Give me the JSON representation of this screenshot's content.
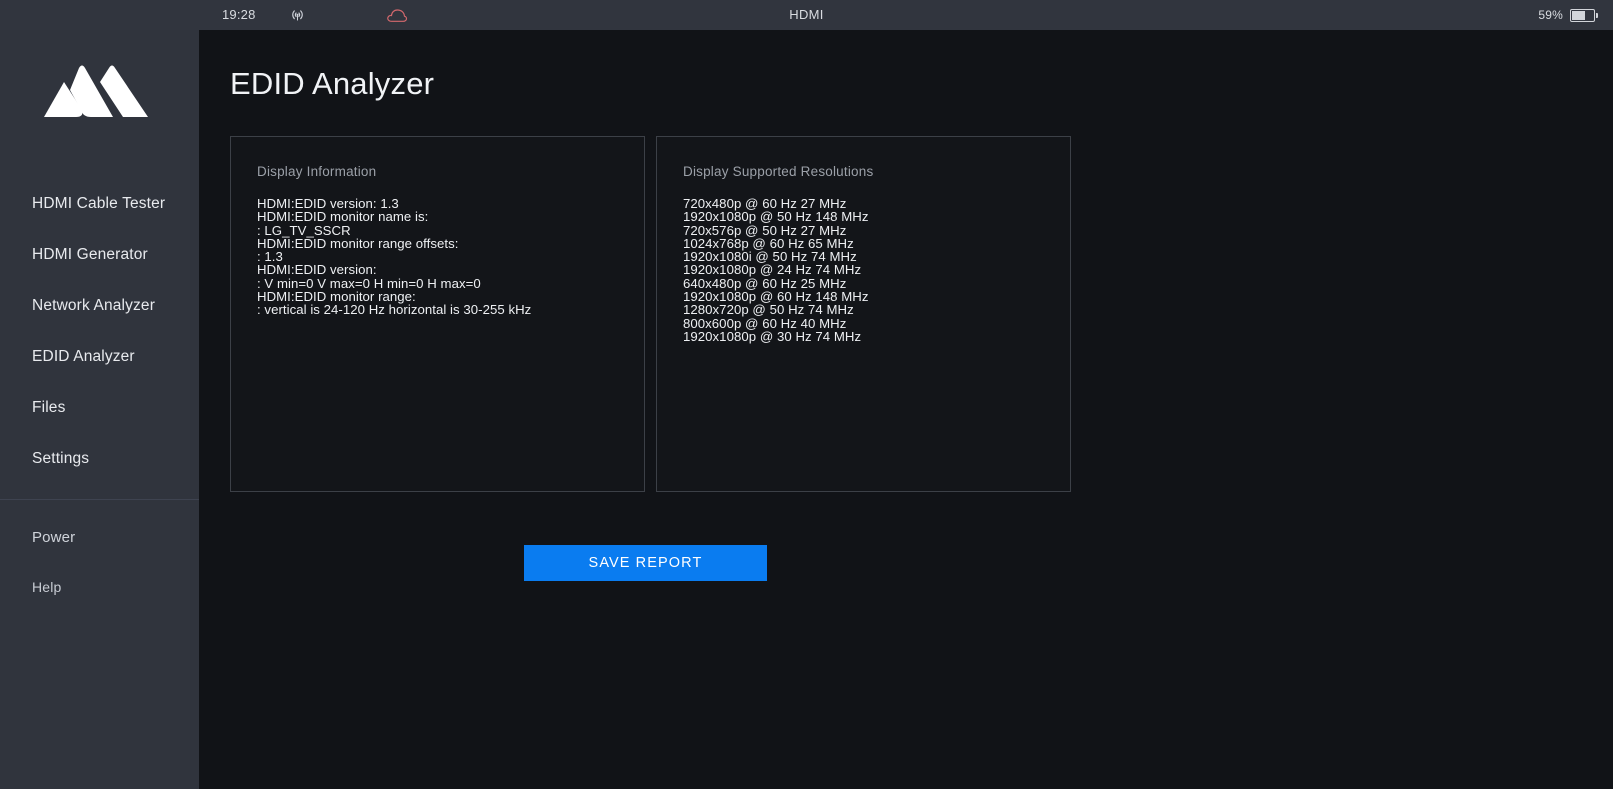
{
  "statusbar": {
    "time": "19:28",
    "broadcast_icon": "broadcast-antenna-icon",
    "cloud_icon": "cloud-icon",
    "cloud_color": "#d3686d",
    "source_label": "HDMI",
    "battery_percent": "59%",
    "battery_level": 59
  },
  "sidebar": {
    "logo_name": "mountain-m-logo",
    "items": [
      {
        "label": "HDMI Cable Tester",
        "name": "sidebar-item-hdmi-cable-tester"
      },
      {
        "label": "HDMI Generator",
        "name": "sidebar-item-hdmi-generator"
      },
      {
        "label": "Network Analyzer",
        "name": "sidebar-item-network-analyzer"
      },
      {
        "label": "EDID Analyzer",
        "name": "sidebar-item-edid-analyzer"
      },
      {
        "label": "Files",
        "name": "sidebar-item-files"
      },
      {
        "label": "Settings",
        "name": "sidebar-item-settings"
      }
    ],
    "secondary_items": [
      {
        "label": "Power",
        "name": "sidebar-item-power"
      },
      {
        "label": "Help",
        "name": "sidebar-item-help"
      }
    ]
  },
  "main": {
    "title": "EDID Analyzer",
    "display_information": {
      "label": "Display Information",
      "lines": [
        "HDMI:EDID version: 1.3",
        "HDMI:EDID monitor name is:",
        ": LG_TV_SSCR",
        "HDMI:EDID monitor range offsets:",
        ": 1.3",
        "HDMI:EDID version:",
        ": V min=0 V max=0 H min=0 H max=0",
        "HDMI:EDID monitor range:",
        ": vertical is 24-120 Hz horizontal is 30-255 kHz"
      ]
    },
    "supported_resolutions": {
      "label": "Display Supported Resolutions",
      "lines": [
        "720x480p @ 60 Hz 27 MHz",
        "1920x1080p @ 50 Hz 148 MHz",
        "720x576p @ 50 Hz 27 MHz",
        "1024x768p @ 60 Hz 65 MHz",
        "1920x1080i @ 50 Hz 74 MHz",
        "1920x1080p @ 24 Hz 74 MHz",
        "640x480p @ 60 Hz 25 MHz",
        "1920x1080p @ 60 Hz 148 MHz",
        "1280x720p @ 50 Hz 74 MHz",
        "800x600p @ 60 Hz 40 MHz",
        "1920x1080p @ 30 Hz 74 MHz"
      ]
    },
    "save_report_label": "SAVE REPORT",
    "accent_color": "#0a7cf0"
  }
}
